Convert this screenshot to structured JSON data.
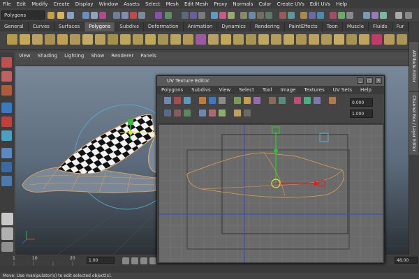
{
  "menubar": {
    "items": [
      "File",
      "Edit",
      "Modify",
      "Create",
      "Display",
      "Window",
      "Assets",
      "Select",
      "Mesh",
      "Edit Mesh",
      "Proxy",
      "Normals",
      "Color",
      "Create UVs",
      "Edit UVs",
      "Help"
    ]
  },
  "status": {
    "mode": "Polygons"
  },
  "shelf": {
    "tabs": [
      "General",
      "Curves",
      "Surfaces",
      "Polygons",
      "Subdivs",
      "Deformation",
      "Animation",
      "Dynamics",
      "Rendering",
      "PaintEffects",
      "Toon",
      "Muscle",
      "Fluids",
      "Fur"
    ],
    "active": "Polygons"
  },
  "viewport": {
    "menu": [
      "View",
      "Shading",
      "Lighting",
      "Show",
      "Renderer",
      "Panels"
    ]
  },
  "right_panel": {
    "tabs": [
      "Attribute Editor",
      "Channel Box / Layer Editor"
    ]
  },
  "uv_editor": {
    "title": "UV Texture Editor",
    "menu": [
      "Polygons",
      "Subdivs",
      "View",
      "Select",
      "Tool",
      "Image",
      "Textures",
      "UV Sets",
      "Help"
    ],
    "field_value": "0.000",
    "field_value2": "1.000"
  },
  "timeline": {
    "ticks": [
      "1",
      "10",
      "20"
    ],
    "current": "1.00",
    "end": "48.00"
  },
  "help_line": {
    "text": "Move: Use manipulator(s) to edit selected object(s)."
  }
}
